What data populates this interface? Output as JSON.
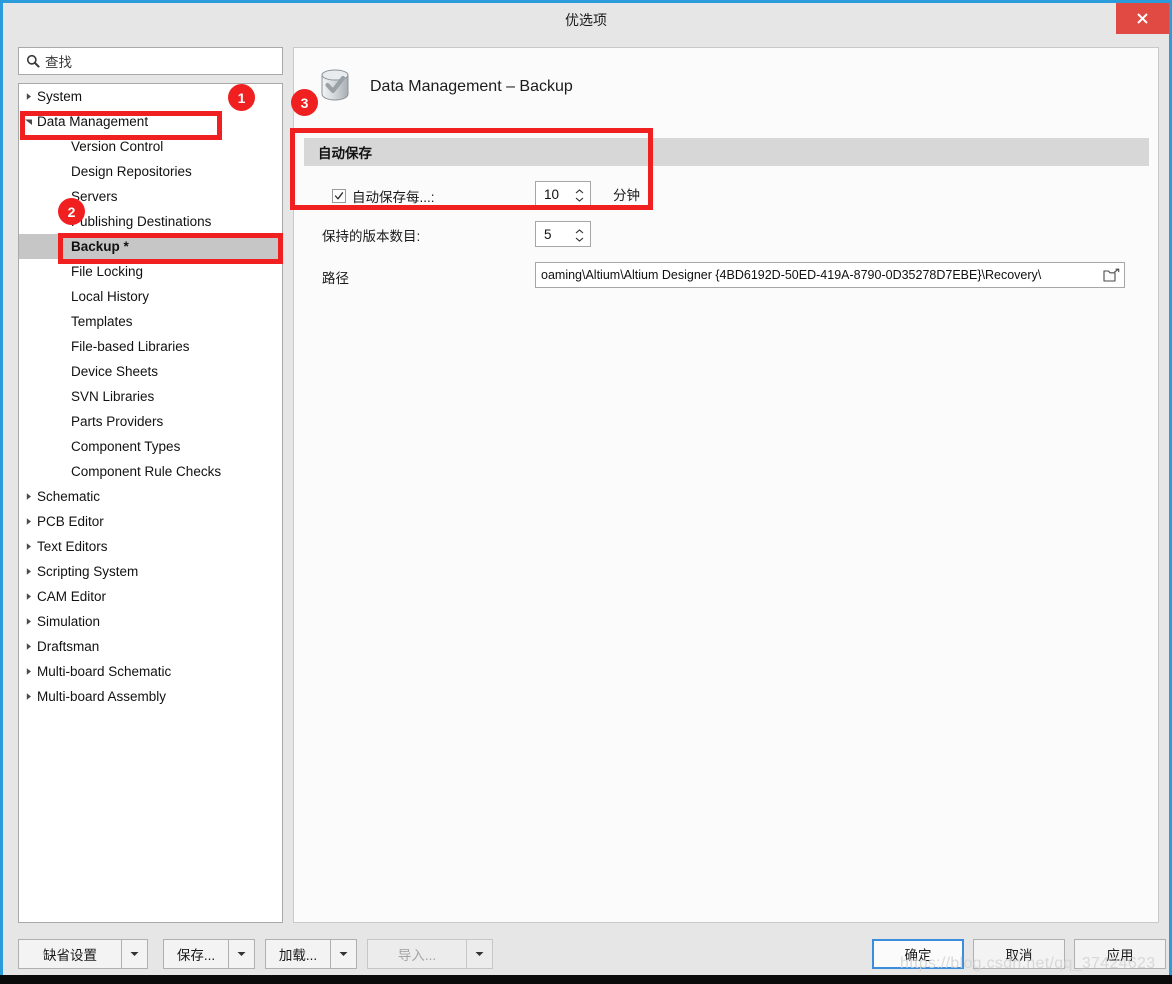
{
  "window": {
    "title": "优选项",
    "close_icon": "close-icon"
  },
  "search": {
    "icon": "search-icon",
    "placeholder": "查找",
    "value": "查找"
  },
  "tree": {
    "items": [
      {
        "label": "System",
        "level": 0,
        "expandable": true,
        "expanded": false,
        "selected": false
      },
      {
        "label": "Data Management",
        "level": 0,
        "expandable": true,
        "expanded": true,
        "selected": false
      },
      {
        "label": "Version Control",
        "level": 1,
        "expandable": false,
        "expanded": false,
        "selected": false
      },
      {
        "label": "Design Repositories",
        "level": 1,
        "expandable": false,
        "expanded": false,
        "selected": false
      },
      {
        "label": "Servers",
        "level": 1,
        "expandable": false,
        "expanded": false,
        "selected": false
      },
      {
        "label": "Publishing Destinations",
        "level": 1,
        "expandable": false,
        "expanded": false,
        "selected": false
      },
      {
        "label": "Backup *",
        "level": 1,
        "expandable": false,
        "expanded": false,
        "selected": true
      },
      {
        "label": "File Locking",
        "level": 1,
        "expandable": false,
        "expanded": false,
        "selected": false
      },
      {
        "label": "Local History",
        "level": 1,
        "expandable": false,
        "expanded": false,
        "selected": false
      },
      {
        "label": "Templates",
        "level": 1,
        "expandable": false,
        "expanded": false,
        "selected": false
      },
      {
        "label": "File-based Libraries",
        "level": 1,
        "expandable": false,
        "expanded": false,
        "selected": false
      },
      {
        "label": "Device Sheets",
        "level": 1,
        "expandable": false,
        "expanded": false,
        "selected": false
      },
      {
        "label": "SVN Libraries",
        "level": 1,
        "expandable": false,
        "expanded": false,
        "selected": false
      },
      {
        "label": "Parts Providers",
        "level": 1,
        "expandable": false,
        "expanded": false,
        "selected": false
      },
      {
        "label": "Component Types",
        "level": 1,
        "expandable": false,
        "expanded": false,
        "selected": false
      },
      {
        "label": "Component Rule Checks",
        "level": 1,
        "expandable": false,
        "expanded": false,
        "selected": false
      },
      {
        "label": "Schematic",
        "level": 0,
        "expandable": true,
        "expanded": false,
        "selected": false
      },
      {
        "label": "PCB Editor",
        "level": 0,
        "expandable": true,
        "expanded": false,
        "selected": false
      },
      {
        "label": "Text Editors",
        "level": 0,
        "expandable": true,
        "expanded": false,
        "selected": false
      },
      {
        "label": "Scripting System",
        "level": 0,
        "expandable": true,
        "expanded": false,
        "selected": false
      },
      {
        "label": "CAM Editor",
        "level": 0,
        "expandable": true,
        "expanded": false,
        "selected": false
      },
      {
        "label": "Simulation",
        "level": 0,
        "expandable": true,
        "expanded": false,
        "selected": false
      },
      {
        "label": "Draftsman",
        "level": 0,
        "expandable": true,
        "expanded": false,
        "selected": false
      },
      {
        "label": "Multi-board Schematic",
        "level": 0,
        "expandable": true,
        "expanded": false,
        "selected": false
      },
      {
        "label": "Multi-board Assembly",
        "level": 0,
        "expandable": true,
        "expanded": false,
        "selected": false
      }
    ]
  },
  "page": {
    "icon": "database-check-icon",
    "title": "Data Management – Backup",
    "section_title": "自动保存",
    "autosave": {
      "checkbox_label": "自动保存每...:",
      "checked": true,
      "interval_value": "10",
      "unit_label": "分钟"
    },
    "versions": {
      "label": "保持的版本数目:",
      "value": "5"
    },
    "path": {
      "label": "路径",
      "value": "oaming\\Altium\\Altium Designer {4BD6192D-50ED-419A-8790-0D35278D7EBE}\\Recovery\\",
      "browse_icon": "folder-open-icon"
    }
  },
  "footer": {
    "defaults_label": "缺省设置",
    "save_label": "保存...",
    "load_label": "加载...",
    "import_label": "导入...",
    "ok_label": "确定",
    "cancel_label": "取消",
    "apply_label": "应用"
  },
  "annotations": {
    "badge1": "1",
    "badge2": "2",
    "badge3": "3"
  },
  "watermark": {
    "text": "https://blog.csdn.net/qq_37424623"
  },
  "colors": {
    "accent": "#2b9bdb",
    "close": "#e04a43",
    "annotation": "#f02020",
    "selection": "#c6c6c6",
    "section_bar": "#d7d7d7"
  }
}
